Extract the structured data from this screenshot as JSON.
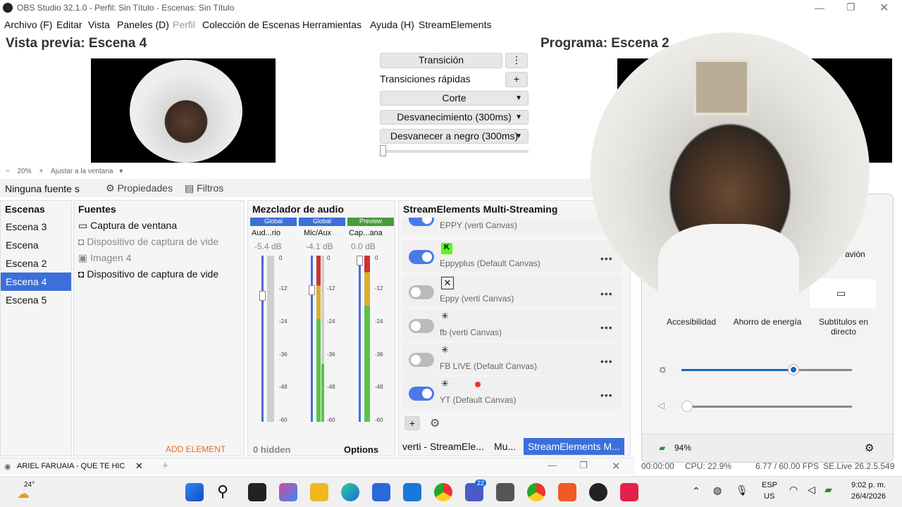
{
  "window": {
    "title": "OBS Studio 32.1.0 - Perfil: Sin Título - Escenas: Sin Título"
  },
  "menu": [
    "Archivo (F)",
    "Editar",
    "Vista",
    "Paneles (D)",
    "Perfil",
    "Colección de Escenas",
    "Herramientas",
    "Ayuda (H)",
    "StreamElements"
  ],
  "preview": {
    "title": "Vista previa: Escena 4",
    "zoom": "20%",
    "fit_label": "Ajustar a la ventana"
  },
  "program": {
    "title": "Programa: Escena 2"
  },
  "transitions": {
    "transition": "Transición",
    "quick": "Transiciones rápidas",
    "cut": "Corte",
    "fade": "Desvanecimiento (300ms)",
    "fade_black": "Desvanecer a negro (300ms)",
    "menu_icon": "⋮",
    "add_icon": "+"
  },
  "source_bar": {
    "no_source": "Ninguna fuente s",
    "properties": "Propiedades",
    "filters": "Filtros"
  },
  "scenes": {
    "title": "Escenas",
    "items": [
      "Escena 3",
      "Escena",
      "Escena 2",
      "Escena 4",
      "Escena 5"
    ],
    "selected": "Escena 4"
  },
  "sources": {
    "title": "Fuentes",
    "items": [
      "Captura de ventana",
      "Dispositivo de captura de vide",
      "Imagen 4",
      "Dispositivo de captura de vide"
    ],
    "add_element": "ADD ELEMENT"
  },
  "mixer": {
    "title": "Mezclador de audio",
    "channels": [
      {
        "tag": "Global",
        "name": "Aud...rio",
        "db": "-5.4 dB"
      },
      {
        "tag": "Global",
        "name": "Mic/Aux",
        "db": "-4.1 dB"
      },
      {
        "tag": "Preview",
        "name": "Cap...ana",
        "db": "0.0 dB"
      }
    ],
    "ticks": [
      "0",
      "-6",
      "-12",
      "-18",
      "-24",
      "-30",
      "-36",
      "-42",
      "-48",
      "-54",
      "-60"
    ],
    "hidden": "0 hidden",
    "options": "Options"
  },
  "multistream": {
    "title": "StreamElements Multi-Streaming",
    "rows": [
      {
        "name": "EPPY (verti Canvas)",
        "on": true
      },
      {
        "name": "Eppyplus (Default Canvas)",
        "on": true
      },
      {
        "name": "Eppy (verti Canvas)",
        "on": false
      },
      {
        "name": "fb (verti Canvas)",
        "on": false
      },
      {
        "name": "FB LIVE (Default Canvas)",
        "on": false
      },
      {
        "name": "YT (Default Canvas)",
        "on": true
      }
    ],
    "more_icon": "•••",
    "add_icon": "+",
    "tabs": [
      "verti - StreamEle...",
      "Mu...",
      "StreamElements M..."
    ]
  },
  "quick_settings": {
    "tiles": [
      "Accesibilidad",
      "Ahorro de energía",
      "Subtítulos en directo"
    ],
    "partial_tile": "avión",
    "brightness": 0.66,
    "volume": 0.0,
    "battery": "94%"
  },
  "status": {
    "time": "00:00:00",
    "cpu": "CPU: 22.9%",
    "fps": "6.77 / 60.00 FPS",
    "se": "SE.Live 26.2.5.549"
  },
  "browser_tab": {
    "title": "ARIEL FARUAIA - QUE TE HIC"
  },
  "taskbar": {
    "temp": "24°",
    "lang": "ESP",
    "region": "US",
    "time": "9:02 p. m.",
    "date": "26/4/2026",
    "badge": "22"
  },
  "colors": {
    "accent": "#4a7ae8",
    "selected": "#3c6fd9",
    "meter_green": "#5cc24a",
    "meter_blue": "#4a6ae0"
  }
}
